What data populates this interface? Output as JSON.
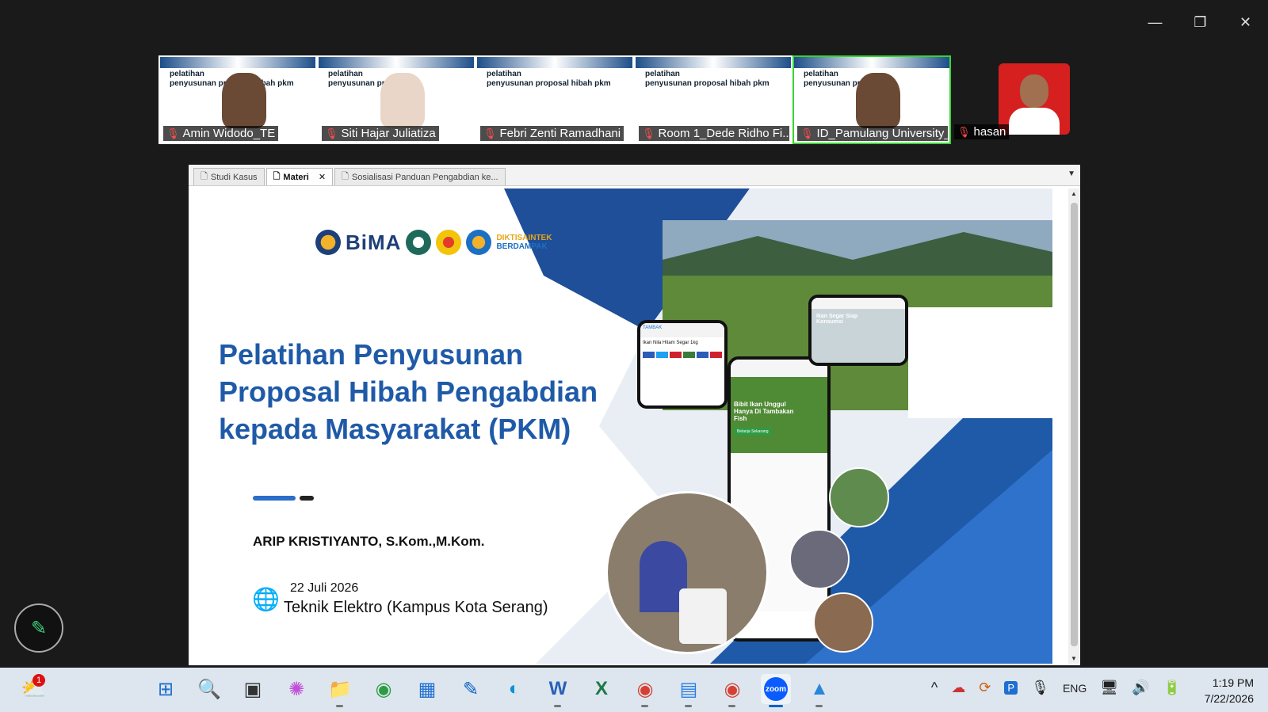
{
  "window": {
    "minimize": "—",
    "restore": "❐",
    "close": "✕"
  },
  "participants": [
    {
      "name": "Amin Widodo_TE",
      "title": "pelatihan\npenyusunan proposal hibah pkm",
      "video": "dark",
      "active": false
    },
    {
      "name": "Siti Hajar Juliatiza",
      "title": "pelatihan\npenyusunan pr",
      "video": "light",
      "active": false
    },
    {
      "name": "Febri Zenti Ramadhani",
      "title": "pelatihan\npenyusunan proposal hibah pkm",
      "video": "none",
      "active": false
    },
    {
      "name": "Room 1_Dede Ridho Fi...",
      "title": "pelatihan\npenyusunan proposal hibah pkm",
      "video": "none",
      "active": false
    },
    {
      "name": "ID_Pamulang University_A...",
      "title": "pelatihan\npenyusunan pro",
      "video": "dark",
      "active": true
    }
  ],
  "self_view": {
    "name": "hasan"
  },
  "browser_tabs": [
    {
      "label": "Studi Kasus",
      "active": false
    },
    {
      "label": "Materi",
      "active": true
    },
    {
      "label": "Sosialisasi Panduan Pengabdian ke...",
      "active": false
    }
  ],
  "slide": {
    "logo_text": "BiMA",
    "logo_tag_1": "DIKTISAINTEK",
    "logo_tag_2": "BERDAMPAK",
    "title": "Pelatihan Penyusunan Proposal Hibah Pengabdian kepada Masyarakat (PKM)",
    "presenter": "ARIP KRISTIYANTO, S.Kom.,M.Kom.",
    "date": "22 Juli 2026",
    "place": "Teknik Elektro (Kampus Kota Serang)",
    "phone_headline": "Bibit Ikan Unggul Hanya Di Tambakan Fish",
    "phone_sub": "Ikan Segar Siap Konsumsi",
    "phone_product": "Ikan Nila Hitam Segar 1kg",
    "phone_cta": "Belanja Sekarang"
  },
  "taskbar": {
    "notification_count": "1",
    "apps": [
      {
        "icon": "windows-start-icon",
        "glyph": "⊞",
        "color": "#1f6fd1",
        "state": ""
      },
      {
        "icon": "search-icon",
        "glyph": "🔍",
        "color": "#1f6fd1",
        "state": ""
      },
      {
        "icon": "task-view-icon",
        "glyph": "▣",
        "color": "#333333",
        "state": ""
      },
      {
        "icon": "copilot-icon",
        "glyph": "✺",
        "color": "#c04fd8",
        "state": ""
      },
      {
        "icon": "file-explorer-icon",
        "glyph": "📁",
        "color": "#e8b020",
        "state": "run"
      },
      {
        "icon": "chrome-icon",
        "glyph": "◉",
        "color": "#2e9b44",
        "state": ""
      },
      {
        "icon": "store-icon",
        "glyph": "▦",
        "color": "#1f6fd1",
        "state": ""
      },
      {
        "icon": "vscode-icon",
        "glyph": "✎",
        "color": "#0a62c6",
        "state": ""
      },
      {
        "icon": "edge-icon",
        "glyph": "◐",
        "color": "#0d8fd6",
        "state": ""
      },
      {
        "icon": "word-icon",
        "glyph": "W",
        "color": "#2b5fb8",
        "state": "run"
      },
      {
        "icon": "excel-icon",
        "glyph": "X",
        "color": "#1d7a45",
        "state": ""
      },
      {
        "icon": "chrome-profile-icon",
        "glyph": "◉",
        "color": "#d64032",
        "state": "run"
      },
      {
        "icon": "notepad-icon",
        "glyph": "▤",
        "color": "#2a7de1",
        "state": "run"
      },
      {
        "icon": "chrome-profile-2-icon",
        "glyph": "◉",
        "color": "#d64032",
        "state": "run"
      },
      {
        "icon": "zoom-icon",
        "glyph": "zoom",
        "color": "#0b5cff",
        "state": "focus"
      },
      {
        "icon": "photos-icon",
        "glyph": "▲",
        "color": "#2a86d8",
        "state": "run"
      }
    ],
    "tray": {
      "chevron": "^",
      "onedrive": "☁",
      "sync": "⟳",
      "pinyin": "P",
      "mic": "🎙",
      "lang": "ENG",
      "network": "🖥",
      "volume": "🔊",
      "battery": "🔋"
    },
    "time": "1:19 PM",
    "date": "7/22/2026"
  }
}
